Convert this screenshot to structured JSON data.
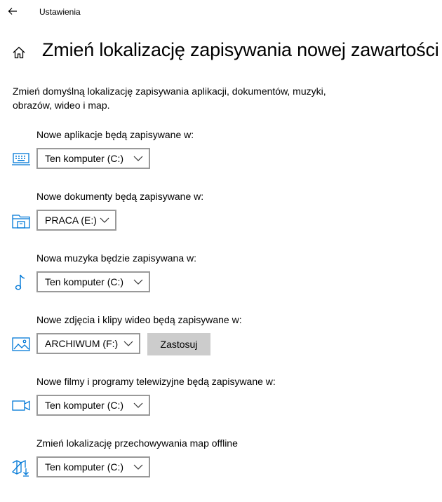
{
  "window": {
    "title": "Ustawienia"
  },
  "page": {
    "title": "Zmień lokalizację zapisywania nowej zawartości",
    "description": "Zmień domyślną lokalizację zapisywania aplikacji, dokumentów, muzyki, obrazów, wideo i map."
  },
  "settings": [
    {
      "label": "Nowe aplikacje będą zapisywane w:",
      "icon": "keyboard-icon",
      "value": "Ten komputer (C:)"
    },
    {
      "label": "Nowe dokumenty będą zapisywane w:",
      "icon": "documents-folder-icon",
      "value": "PRACA (E:)"
    },
    {
      "label": "Nowa muzyka będzie zapisywana w:",
      "icon": "music-note-icon",
      "value": "Ten komputer (C:)"
    },
    {
      "label": "Nowe zdjęcia i klipy wideo będą zapisywane w:",
      "icon": "picture-icon",
      "value": "ARCHIWUM (F:)",
      "apply_label": "Zastosuj"
    },
    {
      "label": "Nowe filmy i programy telewizyjne będą zapisywane w:",
      "icon": "video-camera-icon",
      "value": "Ten komputer (C:)"
    },
    {
      "label": "Zmień lokalizację przechowywania map offline",
      "icon": "map-download-icon",
      "value": "Ten komputer (C:)"
    }
  ],
  "colors": {
    "accent": "#0078D7",
    "dropdown_border": "#999999",
    "button_bg": "#CCCCCC"
  }
}
